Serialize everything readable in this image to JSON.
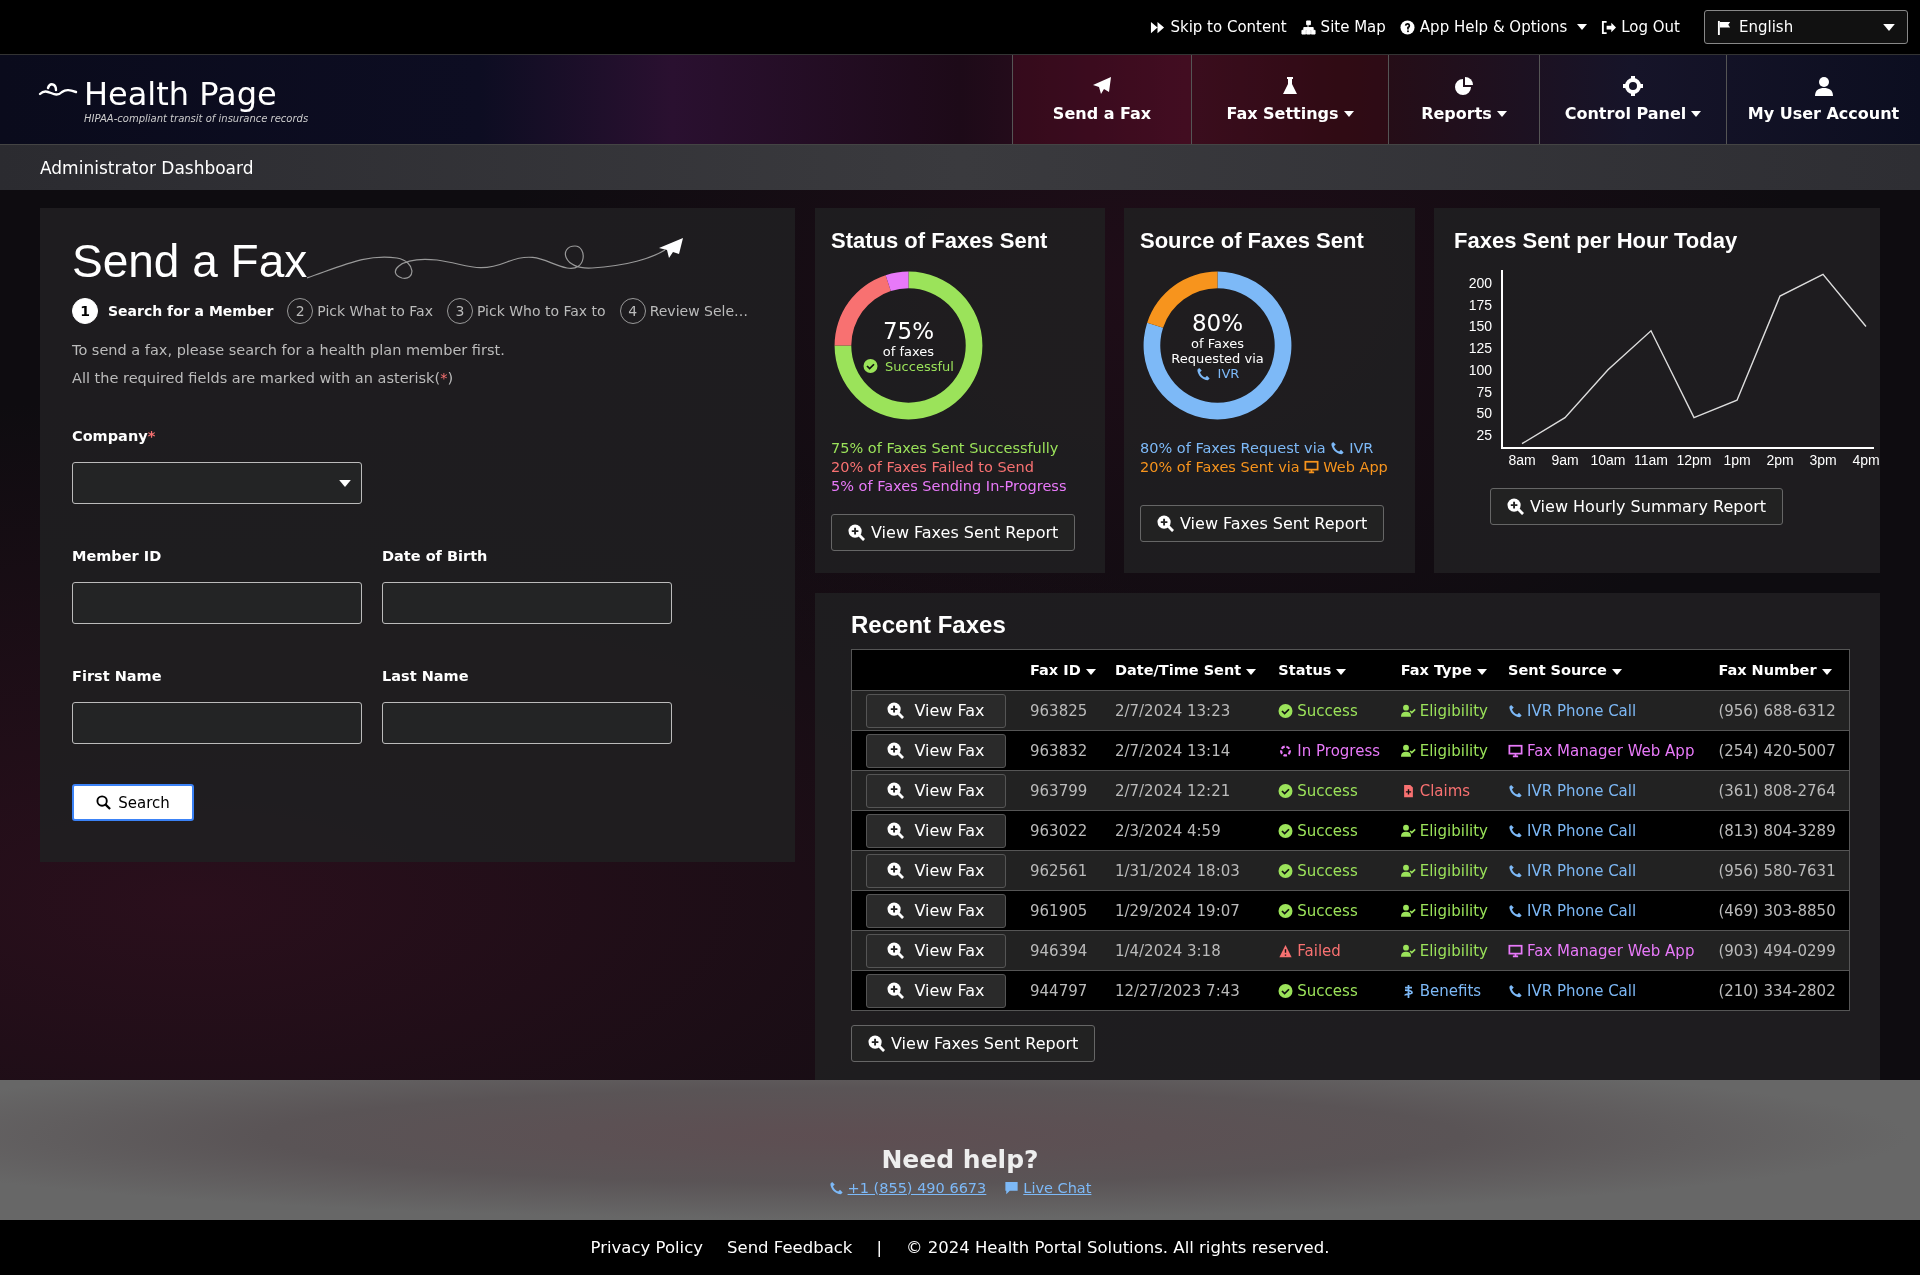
{
  "top_bar": {
    "links": [
      {
        "kind": "skip",
        "label": "Skip to Content",
        "caret": false
      },
      {
        "kind": "sitemap",
        "label": "Site Map",
        "caret": false
      },
      {
        "kind": "help",
        "label": "App Help & Options",
        "caret": true
      },
      {
        "kind": "logout",
        "label": "Log Out",
        "caret": false
      }
    ],
    "language": {
      "value": "English"
    }
  },
  "header": {
    "title": "Health Page",
    "tagline": "HIPAA-compliant transit of insurance records",
    "nav": [
      {
        "kind": "plane",
        "label": "Send a Fax",
        "caret": false
      },
      {
        "kind": "flask",
        "label": "Fax Settings",
        "caret": true
      },
      {
        "kind": "pie",
        "label": "Reports",
        "caret": true
      },
      {
        "kind": "gear",
        "label": "Control Panel",
        "caret": true
      },
      {
        "kind": "user",
        "label": "My User Account",
        "caret": false
      }
    ],
    "breadcrumb": "Administrator Dashboard"
  },
  "send_fax": {
    "title": "Send a Fax",
    "steps": [
      {
        "number": "1",
        "label": "Search for a Member",
        "selected": true
      },
      {
        "number": "2",
        "label": "Pick What to Fax",
        "selected": false
      },
      {
        "number": "3",
        "label": "Pick Who to Fax to",
        "selected": false
      },
      {
        "number": "4",
        "label": "Review Sele…",
        "selected": false
      }
    ],
    "intro": "To send a fax, please search for a health plan member first.",
    "note_before": "All the required fields are marked with an asterisk(",
    "note_mark": "*",
    "note_after": ")",
    "company": {
      "label": "Company",
      "required_mark": "*"
    },
    "fields": [
      {
        "label": "Member ID"
      },
      {
        "label": "Date of Birth"
      },
      {
        "label": "First Name"
      },
      {
        "label": "Last Name"
      }
    ],
    "search_button": "Search"
  },
  "status_card": {
    "title": "Status of Faxes Sent",
    "center_value": "75%",
    "center_line": "of faxes",
    "center_status": "Successful",
    "chart_data": {
      "type": "donut",
      "values": [
        75,
        20,
        5
      ]
    },
    "legend": [
      {
        "text": "75% of Faxes Sent Successfully",
        "color": "#9be35a"
      },
      {
        "text": "20% of Faxes Failed to Send",
        "color": "#f87171"
      },
      {
        "text": "5% of Faxes Sending In-Progress",
        "color": "#e879f9"
      }
    ],
    "button": "View Faxes Sent Report"
  },
  "source_card": {
    "title": "Source of Faxes Sent",
    "center_value": "80%",
    "center_line": "of Faxes",
    "center_line_2": "Requested via",
    "center_source": "IVR",
    "chart_data": {
      "type": "donut",
      "values": [
        80,
        20
      ]
    },
    "legend": [
      {
        "kind": "ivr",
        "text": "80% of Faxes Request via",
        "source": "IVR",
        "color": "#7db9f7"
      },
      {
        "kind": "web",
        "text": "20% of Faxes Sent via",
        "source": "Web App",
        "color": "#f7941d"
      }
    ],
    "button": "View Faxes Sent Report"
  },
  "hourly_card": {
    "title": "Faxes Sent per Hour Today",
    "chart_data": {
      "type": "line",
      "categories": [
        "8am",
        "9am",
        "10am",
        "11am",
        "12pm",
        "1pm",
        "2pm",
        "3pm",
        "4pm"
      ],
      "values": [
        15,
        45,
        100,
        145,
        45,
        65,
        185,
        210,
        150
      ],
      "ylim": [
        10,
        215
      ],
      "yticks": [
        25,
        50,
        75,
        100,
        125,
        150,
        175,
        200
      ]
    },
    "button": "View Hourly Summary Report"
  },
  "recent_faxes": {
    "title": "Recent Faxes",
    "columns": [
      "Fax ID",
      "Date/Time Sent",
      "Status",
      "Fax Type",
      "Sent Source",
      "Fax Number"
    ],
    "rows": [
      {
        "action": "View Fax",
        "fax_id": "963825",
        "sent": "2/7/2024 13:23",
        "status": {
          "kind": "success",
          "label": "Success"
        },
        "type": {
          "kind": "eligibility",
          "label": "Eligibility"
        },
        "source": {
          "kind": "ivr",
          "label": "IVR Phone Call"
        },
        "number": "(956) 688-6312"
      },
      {
        "action": "View Fax",
        "fax_id": "963832",
        "sent": "2/7/2024 13:14",
        "status": {
          "kind": "progress",
          "label": "In Progress"
        },
        "type": {
          "kind": "eligibility",
          "label": "Eligibility"
        },
        "source": {
          "kind": "web",
          "label": "Fax Manager Web App"
        },
        "number": "(254) 420-5007"
      },
      {
        "action": "View Fax",
        "fax_id": "963799",
        "sent": "2/7/2024 12:21",
        "status": {
          "kind": "success",
          "label": "Success"
        },
        "type": {
          "kind": "claims",
          "label": "Claims"
        },
        "source": {
          "kind": "ivr",
          "label": "IVR Phone Call"
        },
        "number": "(361) 808-2764"
      },
      {
        "action": "View Fax",
        "fax_id": "963022",
        "sent": "2/3/2024 4:59",
        "status": {
          "kind": "success",
          "label": "Success"
        },
        "type": {
          "kind": "eligibility",
          "label": "Eligibility"
        },
        "source": {
          "kind": "ivr",
          "label": "IVR Phone Call"
        },
        "number": "(813) 804-3289"
      },
      {
        "action": "View Fax",
        "fax_id": "962561",
        "sent": "1/31/2024 18:03",
        "status": {
          "kind": "success",
          "label": "Success"
        },
        "type": {
          "kind": "eligibility",
          "label": "Eligibility"
        },
        "source": {
          "kind": "ivr",
          "label": "IVR Phone Call"
        },
        "number": "(956) 580-7631"
      },
      {
        "action": "View Fax",
        "fax_id": "961905",
        "sent": "1/29/2024 19:07",
        "status": {
          "kind": "success",
          "label": "Success"
        },
        "type": {
          "kind": "eligibility",
          "label": "Eligibility"
        },
        "source": {
          "kind": "ivr",
          "label": "IVR Phone Call"
        },
        "number": "(469) 303-8850"
      },
      {
        "action": "View Fax",
        "fax_id": "946394",
        "sent": "1/4/2024 3:18",
        "status": {
          "kind": "failed",
          "label": "Failed"
        },
        "type": {
          "kind": "eligibility",
          "label": "Eligibility"
        },
        "source": {
          "kind": "web",
          "label": "Fax Manager Web App"
        },
        "number": "(903) 494-0299"
      },
      {
        "action": "View Fax",
        "fax_id": "944797",
        "sent": "12/27/2023 7:43",
        "status": {
          "kind": "success",
          "label": "Success"
        },
        "type": {
          "kind": "benefits",
          "label": "Benefits"
        },
        "source": {
          "kind": "ivr",
          "label": "IVR Phone Call"
        },
        "number": "(210) 334-2802"
      }
    ],
    "button": "View Faxes Sent Report"
  },
  "help": {
    "title": "Need help?",
    "phone": "+1 (855) 490 6673",
    "chat": "Live Chat"
  },
  "footer": {
    "links": [
      "Privacy Policy",
      "Send Feedback"
    ],
    "separator": "|",
    "copyright": "© 2024 Health Portal Solutions. All rights reserved."
  }
}
